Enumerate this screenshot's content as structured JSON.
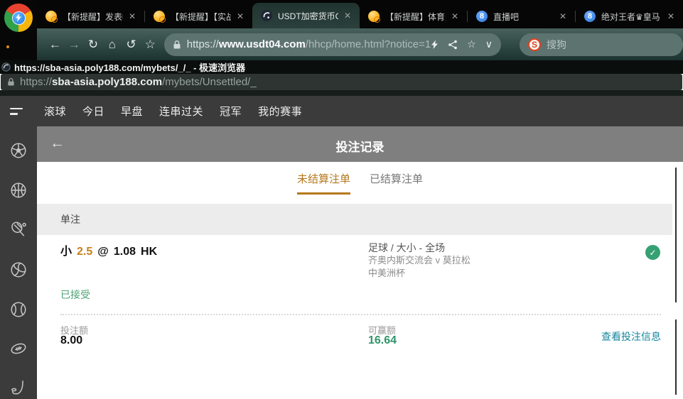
{
  "browser": {
    "tab_close": "✕",
    "tabs": [
      {
        "title": "【新提醒】发表帖"
      },
      {
        "title": "【新提醒】【实战"
      },
      {
        "title": "USDT加密货币G",
        "active": true
      },
      {
        "title": "【新提醒】体育天"
      },
      {
        "title": "直播吧"
      },
      {
        "title": "绝对王者♛皇马"
      }
    ],
    "address": {
      "scheme": "https://",
      "host": "www.usdt04.com",
      "path": "/hhcp/home.html?notice=1"
    },
    "search": {
      "label": "搜狗",
      "logo_letter": "S"
    }
  },
  "popup": {
    "window_title": "https://sba-asia.poly188.com/mybets/_/_ - 极速浏览器",
    "address": {
      "scheme": "https://",
      "host": "sba-asia.poly188.com",
      "path": "/mybets/Unsettled/_"
    }
  },
  "nav": {
    "items": [
      "滚球",
      "今日",
      "早盘",
      "连串过关",
      "冠军",
      "我的赛事"
    ]
  },
  "sidebar": {
    "icons": [
      "soccer",
      "basketball",
      "tennis",
      "volleyball",
      "baseball",
      "american-football",
      "ice-hockey"
    ]
  },
  "icons": {
    "back": "←",
    "forward": "→",
    "reload": "↻",
    "home": "⌂",
    "history": "↺",
    "star": "☆",
    "chevron_down": "∨",
    "check": "✓",
    "live8": "8"
  },
  "page": {
    "title": "投注记录",
    "tabs": {
      "unsettled": "未结算注单",
      "settled": "已结算注单"
    },
    "section_label": "单注",
    "bet": {
      "selection": "小",
      "line": "2.5",
      "at_sign": "@",
      "odds": "1.08",
      "odds_format": "HK",
      "market": "足球 / 大小 - 全场",
      "match": "齐奥内斯交流会 v 莫拉松",
      "league": "中美洲杯",
      "status": "已接受",
      "stake_label": "投注额",
      "stake_value": "8.00",
      "win_label": "可赢额",
      "win_value": "16.64",
      "details_link": "查看投注信息"
    }
  },
  "colors": {
    "accent_orange": "#b5781d",
    "status_green": "#4aa173",
    "check_green": "#35a173",
    "win_green": "#2f9469",
    "link_teal": "#1787a0"
  }
}
